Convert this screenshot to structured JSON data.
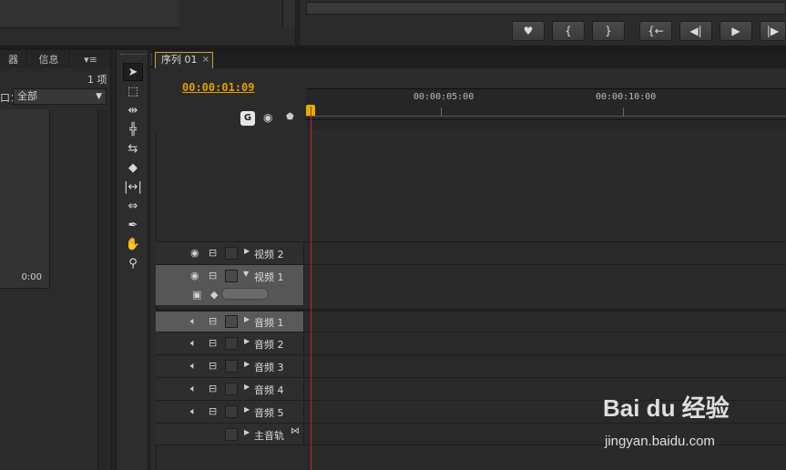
{
  "monitor": {
    "buttons": [
      "♥",
      "{",
      "}",
      "{←",
      "◀|",
      "▶",
      "|▶"
    ]
  },
  "project": {
    "tabs": [
      "器",
      "信息"
    ],
    "count": "1 项",
    "filter_label": "口：",
    "filter_value": "全部",
    "thumb_time": "0:00"
  },
  "timeline": {
    "tab_label": "序列 01",
    "timecode": "00:00:01:09",
    "ruler_labels": [
      "00:00:05:00",
      "00:00:10:00"
    ],
    "tracks": [
      {
        "label": "视频 2",
        "kind": "video"
      },
      {
        "label": "视频 1",
        "kind": "video-expanded"
      },
      {
        "label": "音频 1",
        "kind": "audio",
        "highlight": true
      },
      {
        "label": "音频 2",
        "kind": "audio"
      },
      {
        "label": "音频 3",
        "kind": "audio"
      },
      {
        "label": "音频 4",
        "kind": "audio"
      },
      {
        "label": "音频 5",
        "kind": "audio"
      },
      {
        "label": "主音轨",
        "kind": "master"
      }
    ]
  },
  "watermark": {
    "brand": "Bai du 经验",
    "url": "jingyan.baidu.com"
  }
}
